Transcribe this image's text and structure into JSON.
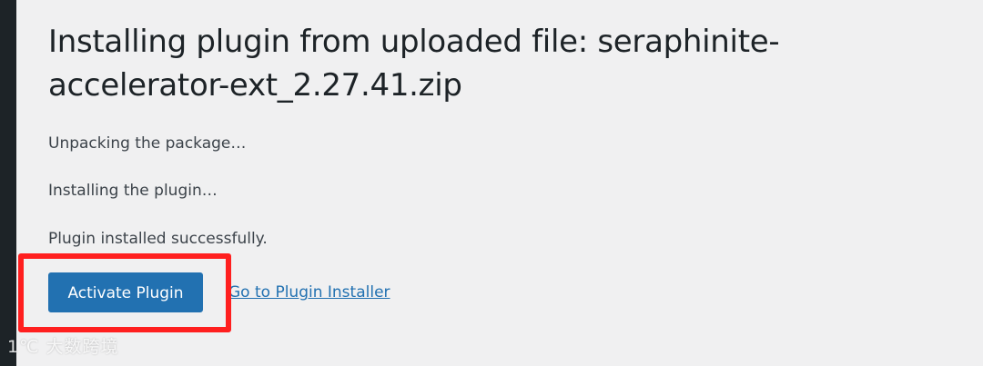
{
  "page": {
    "title": "Installing plugin from uploaded file: seraphinite-accelerator-ext_2.27.41.zip"
  },
  "status_messages": [
    "Unpacking the package…",
    "Installing the plugin…",
    "Plugin installed successfully."
  ],
  "actions": {
    "activate_label": "Activate Plugin",
    "installer_link_label": "Go to Plugin Installer"
  },
  "watermark": {
    "text": "1℃ 大数跨境"
  },
  "colors": {
    "primary": "#2271b1",
    "highlight": "#ff1f1f",
    "background": "#f0f0f1",
    "sidebar": "#1d2327"
  }
}
